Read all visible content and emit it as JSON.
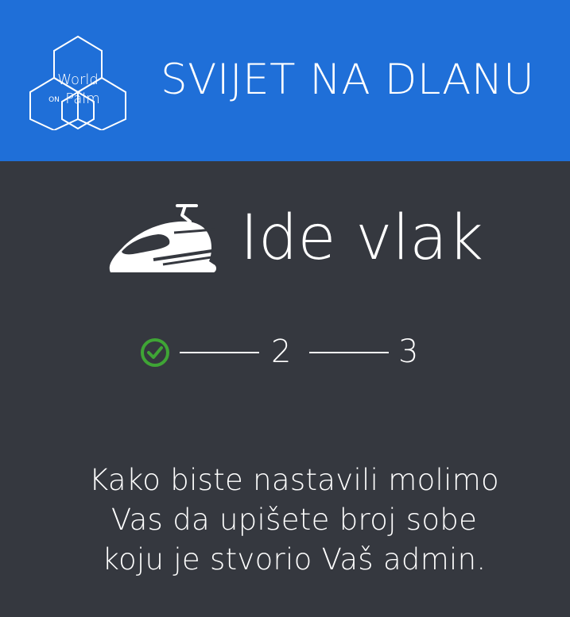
{
  "header": {
    "logo": {
      "icon": "world-on-palm-logo",
      "line1": "World",
      "small": "ON",
      "line2": "Palm"
    },
    "title": "SVIJET NA DLANU",
    "background": "#1f6fd8"
  },
  "hero": {
    "icon": "train-icon",
    "title": "Ide vlak"
  },
  "stepper": {
    "step1": {
      "state": "completed",
      "icon": "check-circle-icon",
      "color": "#3fa535"
    },
    "step2": {
      "label": "2"
    },
    "step3": {
      "label": "3"
    }
  },
  "instructions": {
    "lines": [
      "Kako biste nastavili molimo",
      "Vas da upišete broj sobe",
      "koju je stvorio Vaš admin."
    ]
  },
  "colors": {
    "background": "#35383f",
    "text": "#ffffff"
  }
}
